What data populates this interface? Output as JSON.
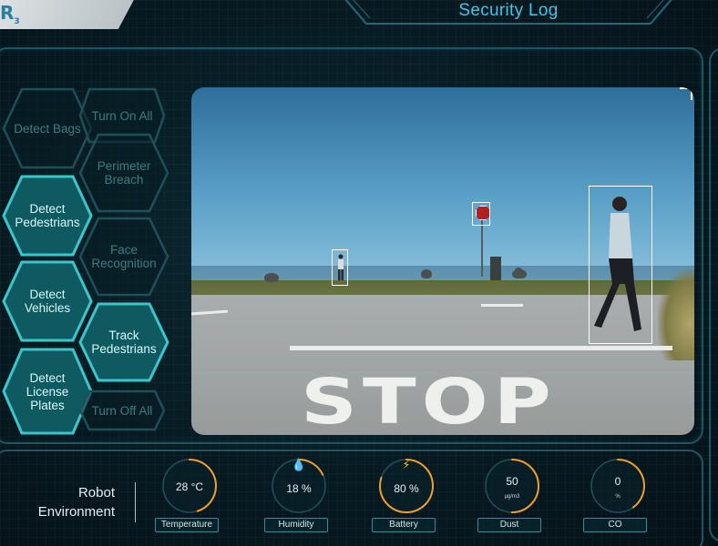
{
  "header": {
    "logo_text": "R",
    "logo_sub": "3",
    "title": "Security Log"
  },
  "colors": {
    "accent": "#3fc6e8",
    "hex_active_fill": "#0e5a60",
    "hex_active_stroke": "#38c8cc",
    "hex_inactive_stroke": "#1f5059",
    "gauge_arc": "#f0a028"
  },
  "hex_buttons": [
    {
      "id": "detect-bags",
      "label": "Detect Bags",
      "active": false
    },
    {
      "id": "turn-on-all",
      "label": "Turn On All",
      "active": false
    },
    {
      "id": "perimeter-breach",
      "label": "Perimeter Breach",
      "active": false
    },
    {
      "id": "detect-pedestrians",
      "label": "Detect Pedestrians",
      "active": true
    },
    {
      "id": "face-recognition",
      "label": "Face Recognition",
      "active": false
    },
    {
      "id": "detect-vehicles",
      "label": "Detect Vehicles",
      "active": true
    },
    {
      "id": "track-pedestrians",
      "label": "Track Pedestrians",
      "active": true
    },
    {
      "id": "detect-license-plates",
      "label": "Detect License Plates",
      "active": true
    },
    {
      "id": "turn-off-all",
      "label": "Turn Off All",
      "active": false
    }
  ],
  "camera": {
    "road_text": "STOP"
  },
  "environment": {
    "label_line1": "Robot",
    "label_line2": "Environment",
    "gauges": [
      {
        "name": "Temperature",
        "value": "28 °C",
        "unit": "",
        "icon": "",
        "fill": 0.45
      },
      {
        "name": "Humidity",
        "value": "18 %",
        "unit": "",
        "icon": "water-drop-icon",
        "fill": 0.18
      },
      {
        "name": "Battery",
        "value": "80 %",
        "unit": "",
        "icon": "lightning-icon",
        "fill": 0.8
      },
      {
        "name": "Dust",
        "value": "50",
        "unit": "µg/m3",
        "icon": "",
        "fill": 0.5
      },
      {
        "name": "CO",
        "value": "0",
        "unit": "%",
        "icon": "",
        "fill": 0.4
      }
    ]
  }
}
